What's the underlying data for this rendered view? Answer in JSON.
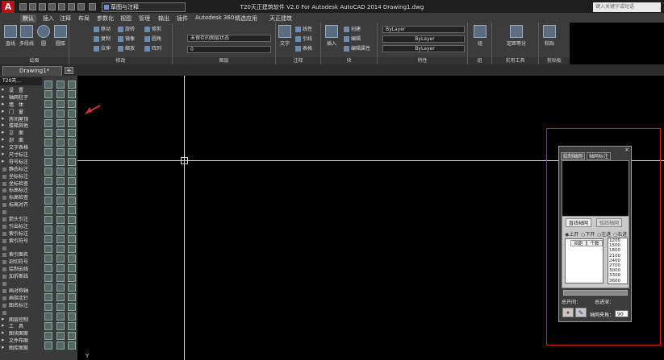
{
  "titlebar": {
    "app_logo": "A",
    "workspace": "草图与注释",
    "title": "T20天正建筑软件 V2.0 For Autodesk AutoCAD 2014    Drawing1.dwg",
    "search_placeholder": "键入关键字或短语"
  },
  "menubar": [
    "默认",
    "插入",
    "注释",
    "布局",
    "参数化",
    "视图",
    "管理",
    "输出",
    "插件",
    "Autodesk 360",
    "精选应用",
    "天正建筑"
  ],
  "ribbon": {
    "draw": {
      "title": "绘图",
      "line": "直线",
      "polyline": "多段线",
      "circle": "圆",
      "arc": "圆弧"
    },
    "modify": {
      "title": "修改",
      "items": [
        "移动",
        "旋转",
        "修剪",
        "复制",
        "镜像",
        "圆角",
        "拉伸",
        "缩放",
        "阵列"
      ]
    },
    "layers": {
      "title": "图层",
      "combo1": "未保存的图层状态",
      "combo2": "0"
    },
    "annotation": {
      "title": "注释",
      "text": "文字",
      "items": [
        "线性",
        "引线",
        "表格"
      ]
    },
    "block": {
      "title": "块",
      "insert": "插入",
      "items": [
        "创建",
        "编辑",
        "编辑属性"
      ]
    },
    "properties": {
      "title": "特性",
      "bylayer1": "ByLayer",
      "bylayer2": "ByLayer",
      "bylayer3": "ByLayer"
    },
    "groups": {
      "title": "组",
      "group": "组"
    },
    "utilities": {
      "title": "实用工具",
      "measure": "测量",
      "label": "定距等分"
    },
    "clipboard": {
      "title": "剪贴板",
      "paste": "粘贴"
    }
  },
  "filetabs": {
    "doc": "Drawing1*"
  },
  "panel": {
    "title": "T20天...",
    "items": [
      {
        "label": "设　置",
        "h": true
      },
      {
        "label": "轴网柱子",
        "h": true
      },
      {
        "label": "墙　体",
        "h": true
      },
      {
        "label": "门　窗",
        "h": true
      },
      {
        "label": "房间屋顶",
        "h": true
      },
      {
        "label": "楼梯其他",
        "h": true
      },
      {
        "label": "立　面",
        "h": true
      },
      {
        "label": "剖　面",
        "h": true
      },
      {
        "label": "文字表格",
        "h": true
      },
      {
        "label": "尺寸标注",
        "h": true
      },
      {
        "label": "符号标注",
        "h": true
      },
      {
        "label": "静态标注",
        "h": false
      },
      {
        "label": "坐标标注",
        "h": false
      },
      {
        "label": "坐标检查",
        "h": false
      },
      {
        "label": "标高标注",
        "h": false
      },
      {
        "label": "标高检查",
        "h": false
      },
      {
        "label": "标高对齐",
        "h": false
      },
      {
        "label": "",
        "h": false
      },
      {
        "label": "箭头引注",
        "h": false
      },
      {
        "label": "引出标注",
        "h": false
      },
      {
        "label": "索引标注",
        "h": false
      },
      {
        "label": "索引符号",
        "h": false
      },
      {
        "label": "",
        "h": false
      },
      {
        "label": "索引图名",
        "h": false
      },
      {
        "label": "剖切符号",
        "h": false
      },
      {
        "label": "绘制云线",
        "h": false
      },
      {
        "label": "加折断线",
        "h": false
      },
      {
        "label": "",
        "h": false
      },
      {
        "label": "画对称轴",
        "h": false
      },
      {
        "label": "画指北针",
        "h": false
      },
      {
        "label": "图名标注",
        "h": false
      },
      {
        "label": "",
        "h": false
      },
      {
        "label": "图层控制",
        "h": true
      },
      {
        "label": "工　具",
        "h": true
      },
      {
        "label": "图块图案",
        "h": true
      },
      {
        "label": "文件布图",
        "h": true
      },
      {
        "label": "图库图案",
        "h": true
      }
    ]
  },
  "axis_dialog": {
    "tab_active": "绘制轴网",
    "tab_2": "轴网标注",
    "grid_tab_active": "直线轴网",
    "grid_tab_2": "弧线轴网",
    "radio": [
      "上开",
      "下开",
      "左进",
      "右进"
    ],
    "table_headers": [
      "间距",
      "个数"
    ],
    "spacing_values": [
      "1200",
      "1500",
      "1800",
      "2100",
      "2400",
      "2700",
      "3000",
      "3300",
      "3600"
    ],
    "total_open_label": "总开间：",
    "total_depth_label": "总进深：",
    "angle_label": "轴网夹角：",
    "angle_value": "90"
  }
}
